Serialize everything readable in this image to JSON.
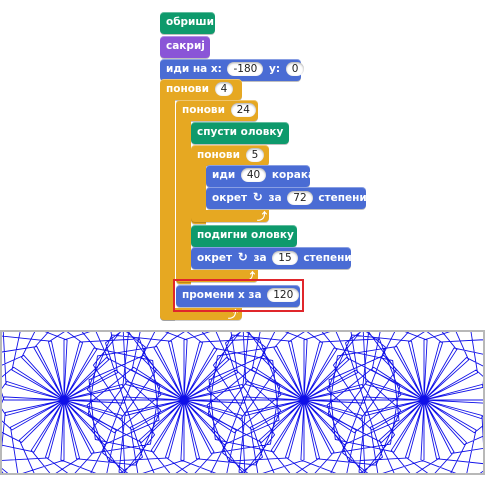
{
  "blocks": {
    "clear": "обриши",
    "hide": "сакриј",
    "goto": {
      "label": "иди на x:",
      "x": "-180",
      "ylabel": "y:",
      "y": "0"
    },
    "repeat1": {
      "label": "понови",
      "count": "4"
    },
    "repeat2": {
      "label": "понови",
      "count": "24"
    },
    "pendown": "спусти оловку",
    "repeat3": {
      "label": "понови",
      "count": "5"
    },
    "move": {
      "label": "иди",
      "steps": "40",
      "suffix": "корака"
    },
    "turn1": {
      "label": "окрет",
      "label2": "за",
      "degrees": "72",
      "suffix": "степени"
    },
    "penup": "подигни оловку",
    "turn2": {
      "label": "окрет",
      "label2": "за",
      "degrees": "15",
      "suffix": "степени"
    },
    "changex": {
      "label": "промени x за",
      "value": "120"
    }
  },
  "colors": {
    "pen": "#0e9a6c",
    "looks": "#8a55d7",
    "motion": "#4a6cd4",
    "control": "#e6a822",
    "highlight": "#e0262b",
    "drawing": "#1010e8"
  },
  "icons": {
    "turn": "rotate-clockwise-icon"
  },
  "stage": {
    "figure_count": 4
  }
}
